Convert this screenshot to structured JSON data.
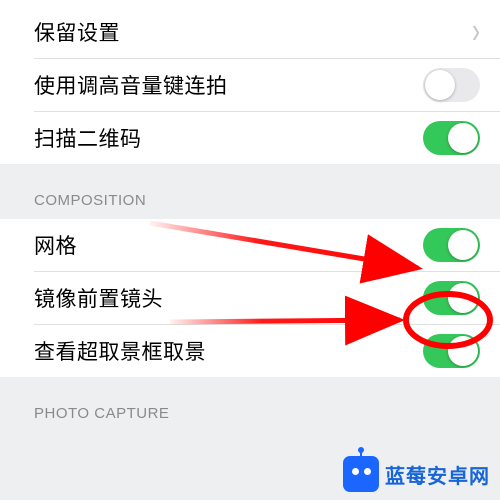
{
  "group1": {
    "items": [
      {
        "label": "保留设置",
        "type": "disclosure"
      },
      {
        "label": "使用调高音量键连拍",
        "type": "toggle",
        "on": false
      },
      {
        "label": "扫描二维码",
        "type": "toggle",
        "on": true
      }
    ]
  },
  "section_composition": {
    "header": "COMPOSITION",
    "items": [
      {
        "label": "网格",
        "type": "toggle",
        "on": true
      },
      {
        "label": "镜像前置镜头",
        "type": "toggle",
        "on": true
      },
      {
        "label": "查看超取景框取景",
        "type": "toggle",
        "on": true
      }
    ]
  },
  "section_photo_capture": {
    "header": "PHOTO CAPTURE"
  },
  "watermark": {
    "text": "蓝莓安卓网"
  },
  "annotations": {
    "circle_target": "镜像前置镜头",
    "arrow_count": 2,
    "color": "#ff0000"
  }
}
